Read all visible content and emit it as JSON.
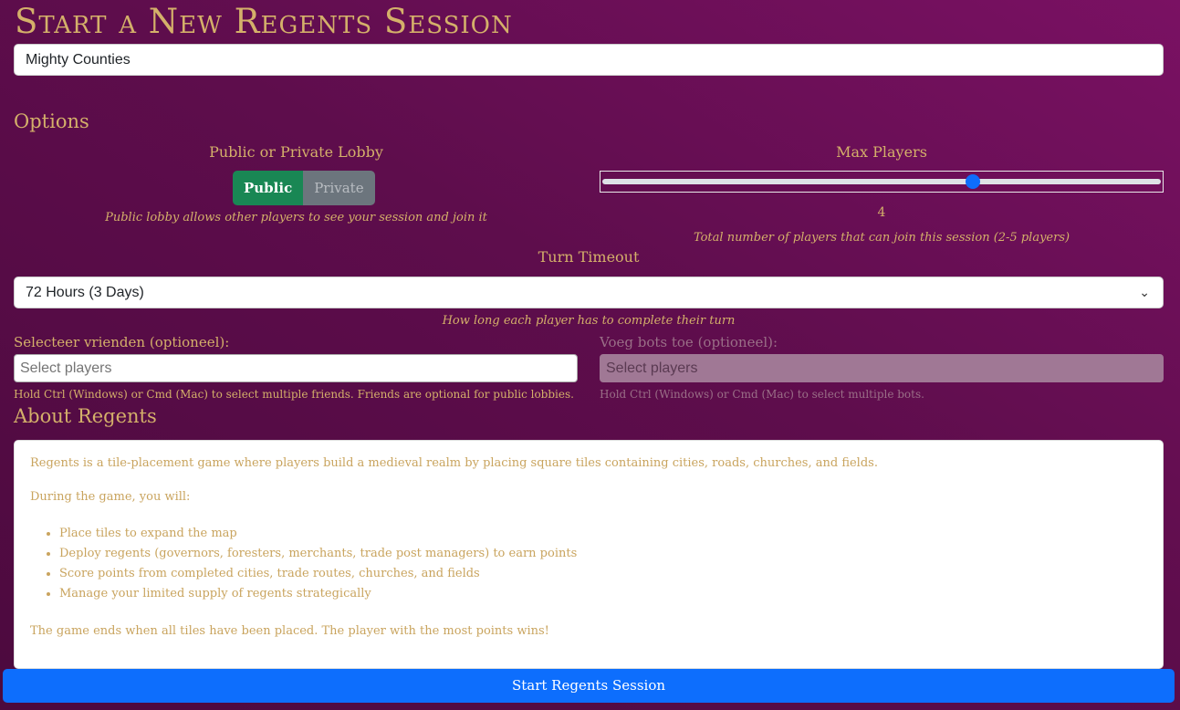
{
  "page": {
    "title": "Start a New Regents Session"
  },
  "session_name": {
    "value": "Mighty Counties"
  },
  "options": {
    "heading": "Options",
    "lobby": {
      "label": "Public or Private Lobby",
      "public_label": "Public",
      "private_label": "Private",
      "selected": "Public",
      "hint": "Public lobby allows other players to see your session and join it"
    },
    "max_players": {
      "label": "Max Players",
      "value": "4",
      "min": 2,
      "max": 5,
      "hint": "Total number of players that can join this session (2-5 players)"
    },
    "turn_timeout": {
      "label": "Turn Timeout",
      "selected": "72 Hours (3 Days)",
      "hint": "How long each player has to complete their turn"
    },
    "friends": {
      "label": "Selecteer vrienden (optioneel):",
      "placeholder": "Select players",
      "hint": "Hold Ctrl (Windows) or Cmd (Mac) to select multiple friends. Friends are optional for public lobbies."
    },
    "bots": {
      "label": "Voeg bots toe (optioneel):",
      "placeholder": "Select players",
      "hint": "Hold Ctrl (Windows) or Cmd (Mac) to select multiple bots."
    }
  },
  "about": {
    "heading": "About Regents",
    "intro": "Regents is a tile-placement game where players build a medieval realm by placing square tiles containing cities, roads, churches, and fields.",
    "during": "During the game, you will:",
    "items": [
      "Place tiles to expand the map",
      "Deploy regents (governors, foresters, merchants, trade post managers) to earn points",
      "Score points from completed cities, trade routes, churches, and fields",
      "Manage your limited supply of regents strategically"
    ],
    "ending": "The game ends when all tiles have been placed. The player with the most points wins!"
  },
  "start_button": {
    "label": "Start Regents Session"
  },
  "colors": {
    "accent_gold": "#d4b06a",
    "primary_blue": "#0d6efd",
    "public_green": "#198754",
    "background_purple": "#5e0d4c"
  }
}
